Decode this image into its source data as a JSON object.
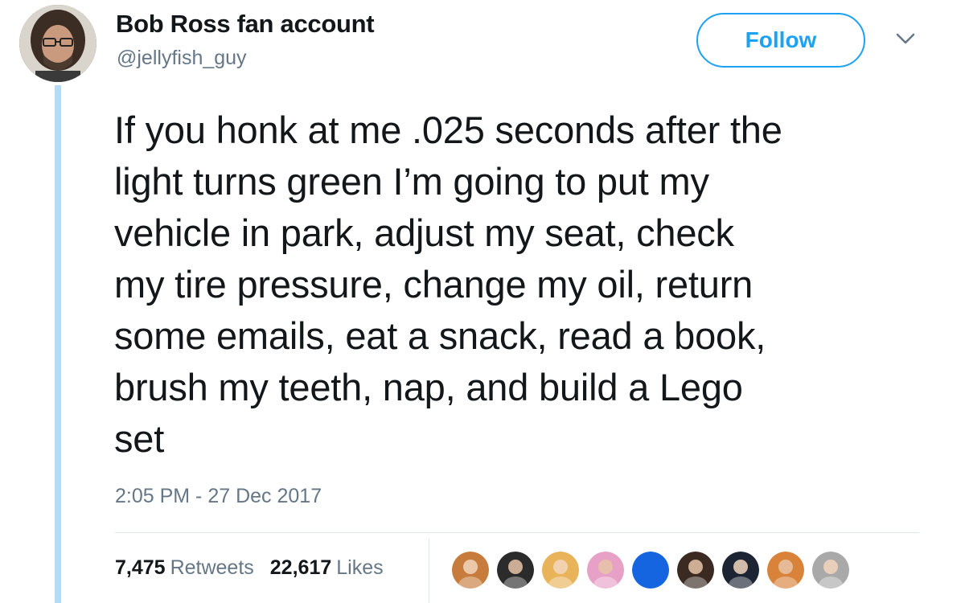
{
  "author": {
    "display_name": "Bob Ross fan account",
    "handle": "@jellyfish_guy"
  },
  "follow_button": {
    "label": "Follow"
  },
  "tweet": {
    "lines": [
      "If you honk at me .025 seconds after the",
      "light turns green I’m going to put my",
      "vehicle in park, adjust my seat, check",
      "my tire pressure, change my oil, return",
      "some emails, eat a snack, read a book,",
      "brush my teeth, nap, and build a Lego",
      "set"
    ],
    "timestamp": "2:05 PM - 27 Dec 2017"
  },
  "stats": {
    "retweets_count": "7,475",
    "retweets_label": "Retweets",
    "likes_count": "22,617",
    "likes_label": "Likes"
  },
  "colors": {
    "accent": "#1da1f2",
    "thread_line": "#b5dcf6",
    "secondary_text": "#657786"
  },
  "liker_avatars": [
    {
      "icon": "user-avatar",
      "color": "#c77b3c"
    },
    {
      "icon": "user-avatar",
      "color": "#2b2b2b"
    },
    {
      "icon": "user-avatar",
      "color": "#e9b35a"
    },
    {
      "icon": "user-avatar",
      "color": "#e7a0c6"
    },
    {
      "icon": "user-avatar",
      "color": "#1565e0"
    },
    {
      "icon": "user-avatar",
      "color": "#3a2a22"
    },
    {
      "icon": "user-avatar",
      "color": "#1d2433"
    },
    {
      "icon": "user-avatar",
      "color": "#d9833a"
    },
    {
      "icon": "user-avatar",
      "color": "#a9a9a9"
    }
  ]
}
